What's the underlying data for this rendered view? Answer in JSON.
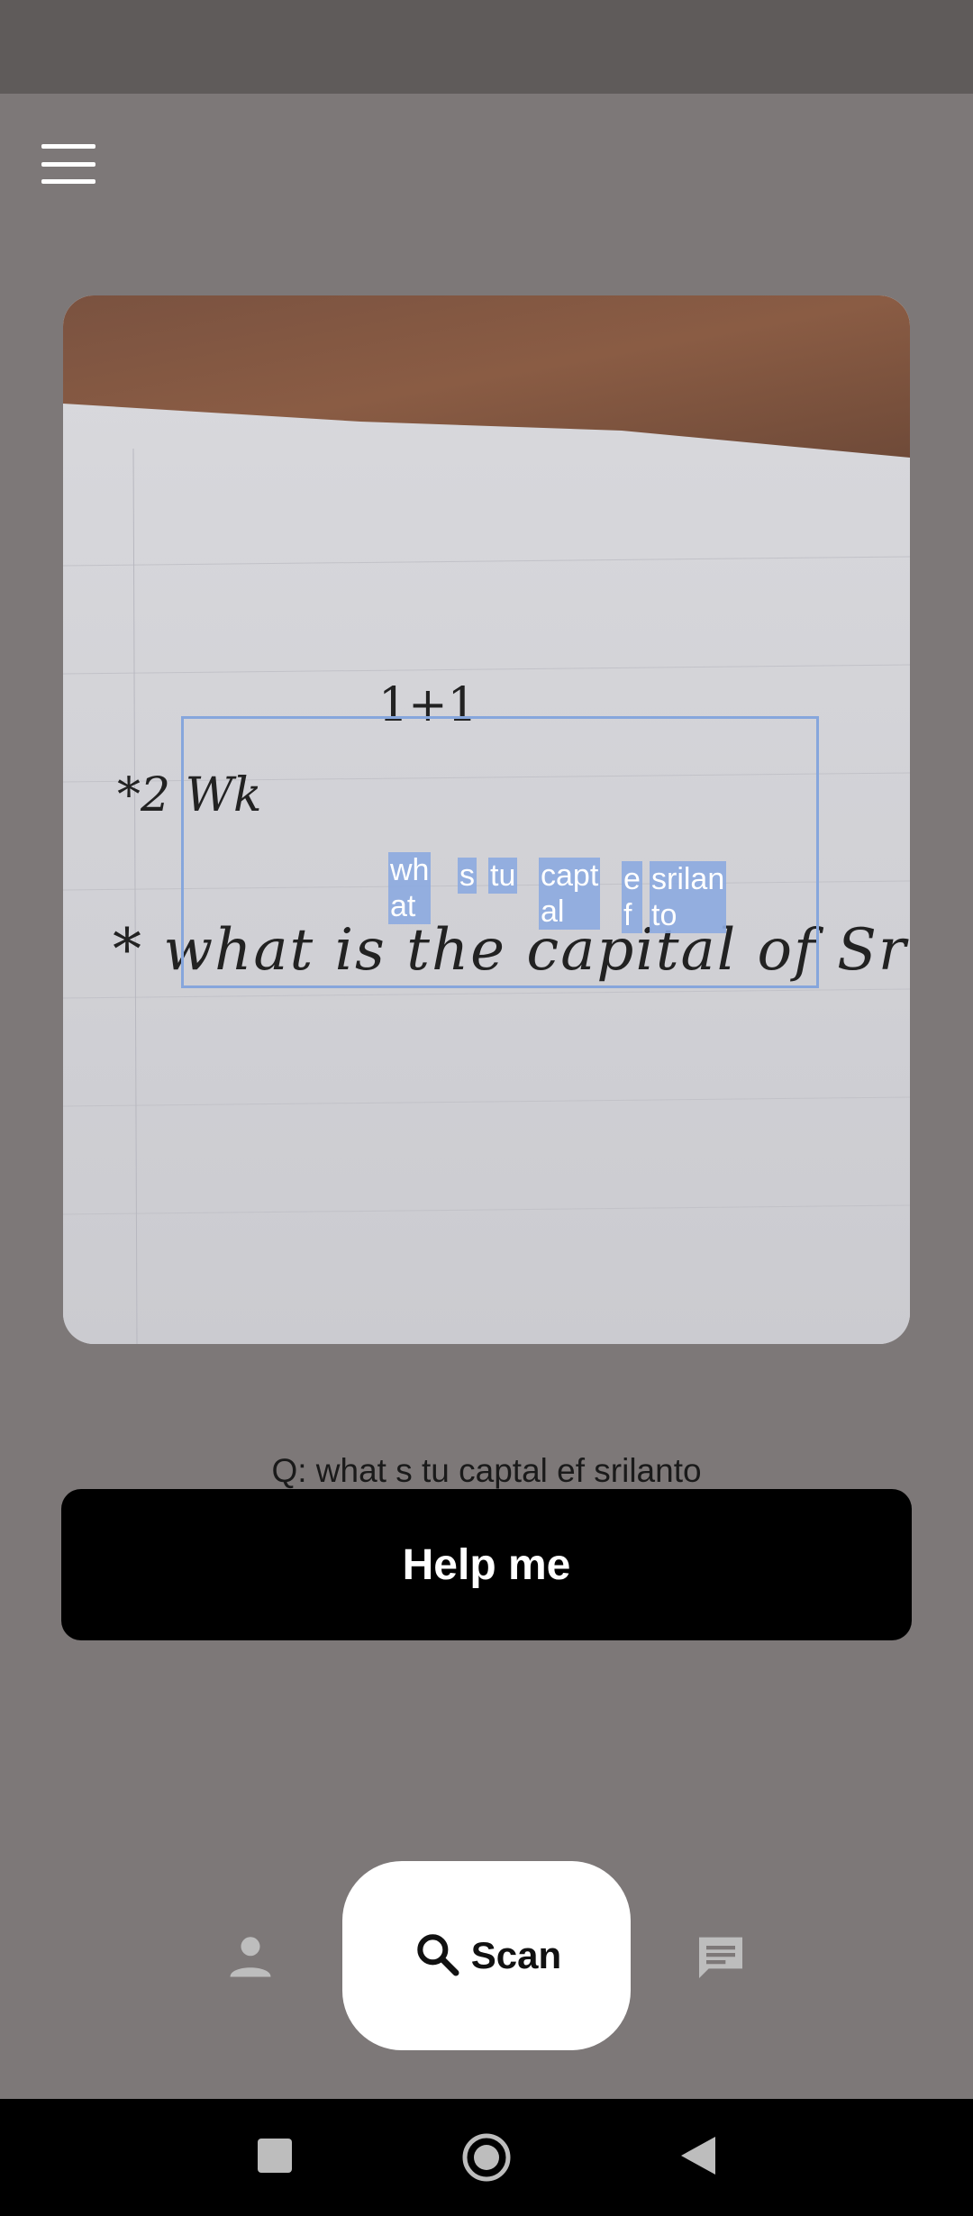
{
  "status_bar": {},
  "header": {
    "menu_icon": "hamburger-menu-icon"
  },
  "scan_preview": {
    "ocr_words": [
      {
        "text": "wh\nat"
      },
      {
        "text": "s"
      },
      {
        "text": "tu"
      },
      {
        "text": "capt\nal"
      },
      {
        "text": "e\nf"
      },
      {
        "text": "srilan\nto"
      }
    ],
    "handwriting": {
      "line_top": "1+1",
      "line_mid": "*2 Wk",
      "line_main": "* what is the capital of Sri"
    }
  },
  "question": {
    "text": "Q:  what s tu captal ef srilanto"
  },
  "help_button": {
    "label": "Help me"
  },
  "bottom_nav": {
    "profile_icon": "person-icon",
    "scan": {
      "label": "Scan",
      "icon": "search-icon"
    },
    "chat_icon": "chat-icon"
  },
  "system_nav": {
    "recents": "square-icon",
    "home": "circle-icon",
    "back": "triangle-back-icon"
  },
  "colors": {
    "background": "#7d7878",
    "status_bar": "#5f5b5a",
    "ocr_highlight": "#8daae0",
    "button": "#000000",
    "scan_pill": "#ffffff"
  }
}
